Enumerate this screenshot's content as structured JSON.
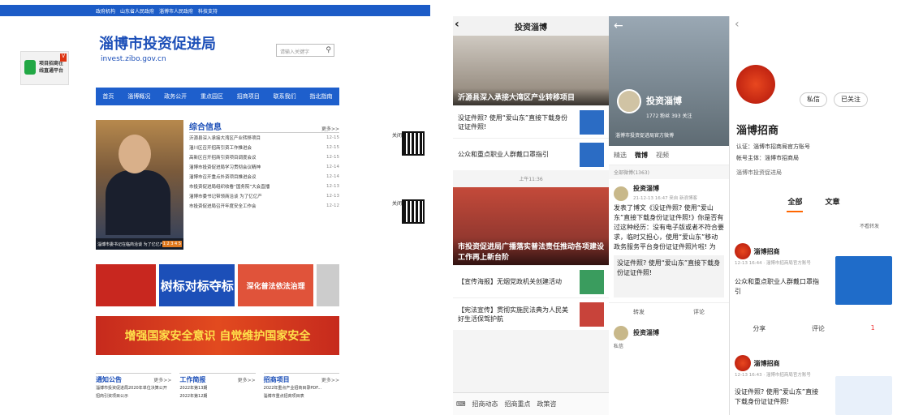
{
  "website": {
    "topnav": [
      "政府机构",
      "山东省人民政府",
      "淄博市人民政府",
      "科技支持"
    ],
    "logo_text": "项目招商在线直通平台",
    "title": "淄博市投资促进局",
    "url": "invest.zibo.gov.cn",
    "search_placeholder": "请输入关键字",
    "nav": [
      "首页",
      "淄博概况",
      "政务公开",
      "重点园区",
      "招商项目",
      "联系我们",
      "指北指南"
    ],
    "photo_caption": "淄博市委书记在临商洽谈 为了亿亿产",
    "photo_pages": "1 2 3 4 5",
    "news_title": "综合信息",
    "more": "更多>>",
    "news": [
      {
        "t": "沂源县深入承接大湾区产业转移项目",
        "d": "12-15"
      },
      {
        "t": "淄川区召开招商引资工作推进会",
        "d": "12-15"
      },
      {
        "t": "高新区召开招商引资项目调度会议",
        "d": "12-15"
      },
      {
        "t": "淄博市投资促进局学习贯彻会议精神",
        "d": "12-14"
      },
      {
        "t": "淄博市召开重点外资项目推进会议",
        "d": "12-14"
      },
      {
        "t": "市投资促进局组织收看“国务院”大会直播",
        "d": "12-13"
      },
      {
        "t": "淄博市委书记带领商洽谈 为了亿亿产",
        "d": "12-13"
      },
      {
        "t": "市投资促进局召开年度安全工作会",
        "d": "12-12"
      }
    ],
    "banner_texts": [
      "树标",
      "对标",
      "夺标",
      "深化普法依法治理"
    ],
    "red_banner": "增强国家安全意识 自觉维护国家安全",
    "cols": [
      {
        "title": "通知公告",
        "items": [
          "淄博市投资促进局2020年单位决算公开",
          "招商引资项目公示"
        ]
      },
      {
        "title": "工作简报",
        "items": [
          "2022年第13期",
          "2022年第12期"
        ]
      },
      {
        "title": "招商项目",
        "items": [
          "2022年重点产业招商目录PDF...",
          "淄博市重点招商项目表"
        ]
      }
    ],
    "qr_close": "关闭"
  },
  "panel1": {
    "header": "投资淄博",
    "photo_caption": "沂源县深入承接大湾区产业转移项目",
    "items": [
      "没证件照? 使用“爱山东”直接下载身份证证件照!",
      "公众和重点职业人群戴口罩指引"
    ],
    "time": "上午11:36",
    "photo2_caption": "市投资促进局广播落实普法责任推动各项建设工作再上新台阶",
    "items2": [
      "【宣传海报】无烟党政机关创建活动",
      "【宪法宣传】贯彻实施民法典为人民美好生活保驾护航"
    ],
    "bar": [
      "招商动态",
      "招商重点",
      "政策咨"
    ]
  },
  "panel2": {
    "name": "投资淄博",
    "stats": "1772 粉丝   393 关注",
    "verify": "淄博市投资促进局官方微博",
    "tabs": [
      "精选",
      "微博",
      "视频"
    ],
    "count": "全部微博(1363)",
    "post_name": "投资淄博",
    "post_time": "21-12-13 16:47 来自 新浪博客",
    "post_text": "发表了博文《没证件照? 使用“爱山东”直接下载身份证证件照!》你是否有过这种经历：没有电子版或者不符合要求，临时又担心，使用“爱山东”移动政务服务平台身份证证件照片啦! 为",
    "quote": "没证件照? 使用“爱山东”直接下载身份证证件照!",
    "actions": [
      "转发",
      "评论"
    ],
    "post2_name": "投资淄博",
    "dm": "私信"
  },
  "panel3": {
    "buttons": [
      "私信",
      "已关注"
    ],
    "name": "淄博招商",
    "lines": [
      "认证：淄博市招商局官方账号",
      "帐号主体：淄博市招商局",
      "淄博市投资促进局"
    ],
    "tabs": [
      "全部",
      "文章"
    ],
    "filter": "不看转发",
    "posts": [
      {
        "name": "淄博招商",
        "time": "12-13 16:44 · 淄博市招商局官方账号",
        "text": "公众和重点职业人群戴口罩指引"
      },
      {
        "name": "淄博招商",
        "time": "12-13 16:43 · 淄博市招商局官方账号",
        "text": "没证件照? 使用“爱山东”直接下载身份证证件照!"
      }
    ],
    "actions": [
      "分享",
      "评论",
      "1"
    ]
  }
}
